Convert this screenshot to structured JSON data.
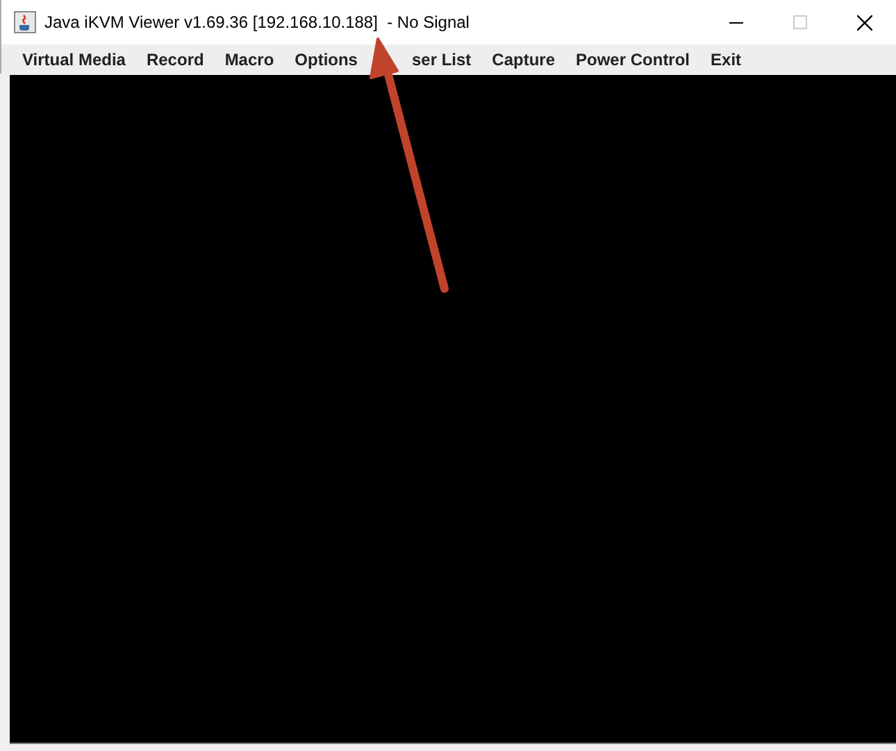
{
  "window": {
    "title": "Java iKVM Viewer v1.69.36 [192.168.10.188]  - No Signal"
  },
  "menu": [
    {
      "label": "Virtual Media"
    },
    {
      "label": "Record"
    },
    {
      "label": "Macro"
    },
    {
      "label": "Options"
    },
    {
      "label": "ser List",
      "kind": "covered"
    },
    {
      "label": "Capture"
    },
    {
      "label": "Power Control"
    },
    {
      "label": "Exit"
    }
  ]
}
